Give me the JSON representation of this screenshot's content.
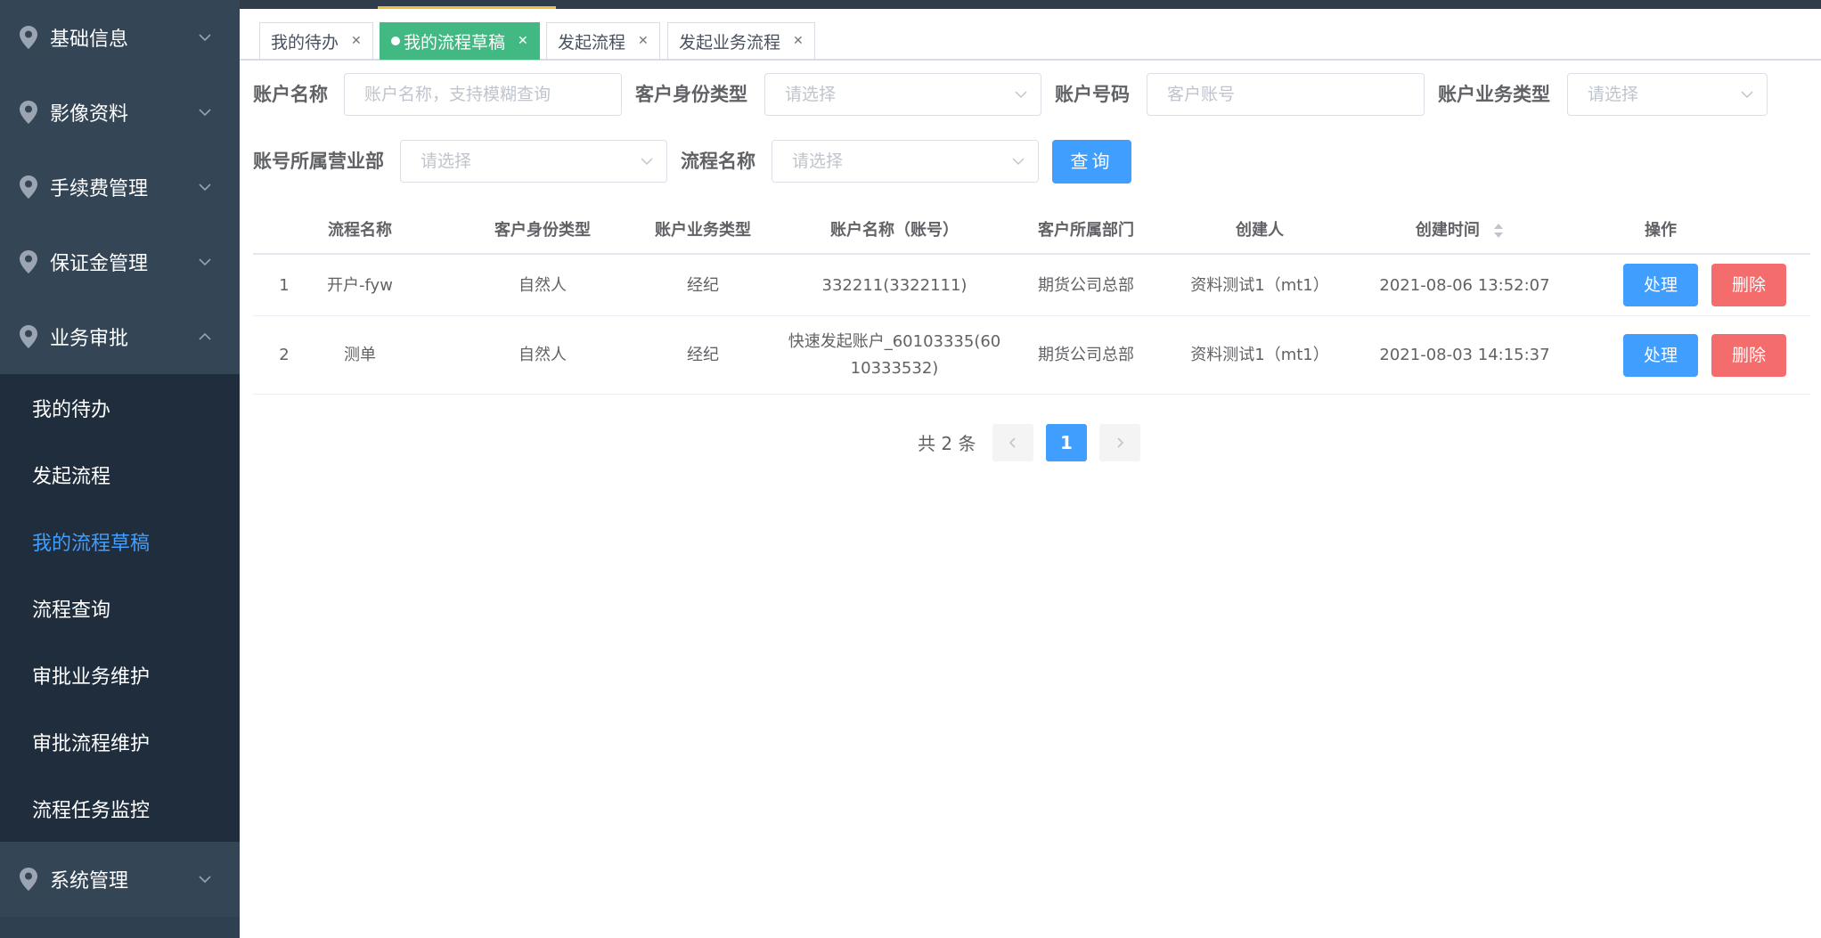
{
  "sidebar": {
    "menus_top": [
      {
        "label": "基础信息"
      },
      {
        "label": "影像资料"
      },
      {
        "label": "手续费管理"
      },
      {
        "label": "保证金管理"
      },
      {
        "label": "业务审批"
      }
    ],
    "submenu": [
      {
        "label": "我的待办"
      },
      {
        "label": "发起流程"
      },
      {
        "label": "我的流程草稿"
      },
      {
        "label": "流程查询"
      },
      {
        "label": "审批业务维护"
      },
      {
        "label": "审批流程维护"
      },
      {
        "label": "流程任务监控"
      }
    ],
    "active_submenu": "我的流程草稿",
    "menu_bottom": {
      "label": "系统管理"
    }
  },
  "tabs": [
    {
      "label": "我的待办"
    },
    {
      "label": "我的流程草稿"
    },
    {
      "label": "发起流程"
    },
    {
      "label": "发起业务流程"
    }
  ],
  "filters": {
    "account_name": {
      "label": "账户名称",
      "placeholder": "账户名称，支持模糊查询"
    },
    "id_type": {
      "label": "客户身份类型",
      "placeholder": "请选择"
    },
    "account_no": {
      "label": "账户号码",
      "placeholder": "客户账号"
    },
    "biz_type": {
      "label": "账户业务类型",
      "placeholder": "请选择"
    },
    "branch": {
      "label": "账号所属营业部",
      "placeholder": "请选择"
    },
    "flow_name": {
      "label": "流程名称",
      "placeholder": "请选择"
    },
    "query_button": "查询"
  },
  "table": {
    "headers": [
      "流程名称",
      "客户身份类型",
      "账户业务类型",
      "账户名称（账号）",
      "客户所属部门",
      "创建人",
      "创建时间",
      "操作"
    ],
    "rows": [
      {
        "index": "1",
        "flow": "开户-fyw",
        "id_type": "自然人",
        "biz_type": "经纪",
        "account": "332211(3322111)",
        "dept": "期货公司总部",
        "creator": "资料测试1（mt1）",
        "created": "2021-08-06 13:52:07",
        "process": "处理",
        "delete": "删除"
      },
      {
        "index": "2",
        "flow": "测单",
        "id_type": "自然人",
        "biz_type": "经纪",
        "account": "快速发起账户_60103335(60 10333532)",
        "dept": "期货公司总部",
        "creator": "资料测试1（mt1）",
        "created": "2021-08-03 14:15:37",
        "process": "处理",
        "delete": "删除"
      }
    ]
  },
  "pagination": {
    "total": "共 2 条",
    "current": "1"
  },
  "colors": {
    "sidebar": "#2f4050",
    "submenu": "#1f2d3d",
    "primary": "#409eff",
    "danger": "#f56c6c",
    "active_tab": "#42b983"
  }
}
